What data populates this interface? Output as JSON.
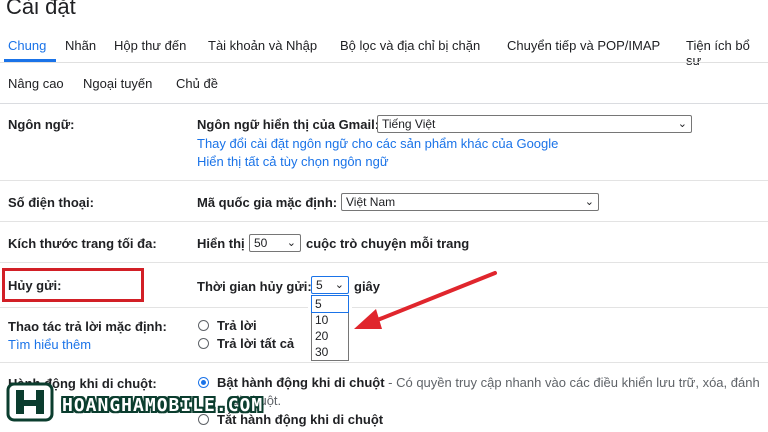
{
  "page": {
    "title": "Cài đặt"
  },
  "tabs_primary": [
    {
      "label": "Chung",
      "active": true
    },
    {
      "label": "Nhãn"
    },
    {
      "label": "Hộp thư đến"
    },
    {
      "label": "Tài khoản và Nhập"
    },
    {
      "label": "Bộ lọc và địa chỉ bị chặn"
    },
    {
      "label": "Chuyển tiếp và POP/IMAP"
    },
    {
      "label": "Tiện ích bổ sư"
    }
  ],
  "tabs_secondary": [
    {
      "label": "Nâng cao"
    },
    {
      "label": "Ngoại tuyến"
    },
    {
      "label": "Chủ đề"
    }
  ],
  "language": {
    "section_label": "Ngôn ngữ:",
    "field_label": "Ngôn ngữ hiển thị của Gmail:",
    "selected": "Tiếng Việt",
    "link_change": "Thay đổi cài đặt ngôn ngữ cho các sản phẩm khác của Google",
    "link_show_all": "Hiển thị tất cả tùy chọn ngôn ngữ"
  },
  "phone": {
    "section_label": "Số điện thoại:",
    "field_label": "Mã quốc gia mặc định:",
    "selected": "Việt Nam"
  },
  "page_size": {
    "section_label": "Kích thước trang tối đa:",
    "prefix": "Hiển thị",
    "selected": "50",
    "suffix": "cuộc trò chuyện mỗi trang"
  },
  "undo_send": {
    "section_label": "Hủy gửi:",
    "field_label": "Thời gian hủy gửi:",
    "selected": "5",
    "suffix": "giây",
    "options": [
      "5",
      "10",
      "20",
      "30"
    ],
    "highlight_color": "#d21f26",
    "arrow_color": "#e0262d"
  },
  "reply_default": {
    "section_label": "Thao tác trả lời mặc định:",
    "learn_more": "Tìm hiểu thêm",
    "option_reply": "Trả lời",
    "option_reply_all": "Trả lời tất cả"
  },
  "hover_actions": {
    "section_label": "Hành động khi di chuột:",
    "option_enable_bold": "Bật hành động khi di chuột",
    "option_enable_desc": " - Có quyền truy cập nhanh vào các điều khiển lưu trữ, xóa, đánh",
    "option_enable_desc2": "di chuột.",
    "option_disable": "Tắt hành động khi di chuột"
  },
  "watermark": {
    "text": "HOANGHAMOBILE.COM",
    "color": "#0b3d2e"
  },
  "colors": {
    "accent": "#1a73e8"
  }
}
